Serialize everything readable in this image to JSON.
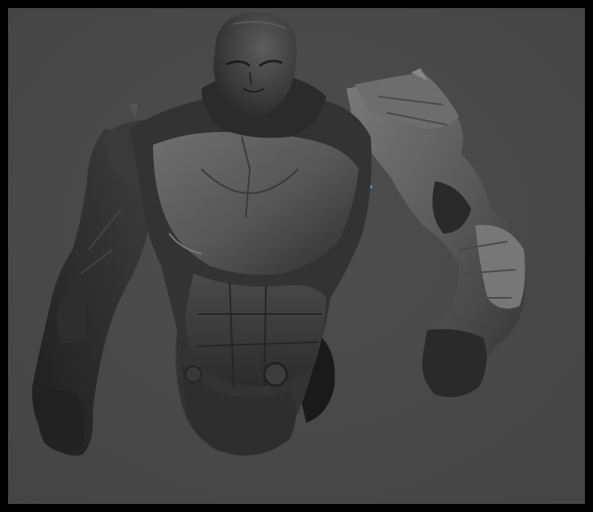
{
  "viewport": {
    "background_color": "#4a4a4a",
    "subject": "armored-figure-render"
  },
  "colors": {
    "frame": "#000000",
    "viewport": "#4a4a4a",
    "armor_dark": "#252525",
    "armor_mid": "#3a3a3a",
    "armor_light": "#6a6a6a",
    "armor_highlight": "#8a8a8a",
    "accent": "#4aa0ff"
  }
}
